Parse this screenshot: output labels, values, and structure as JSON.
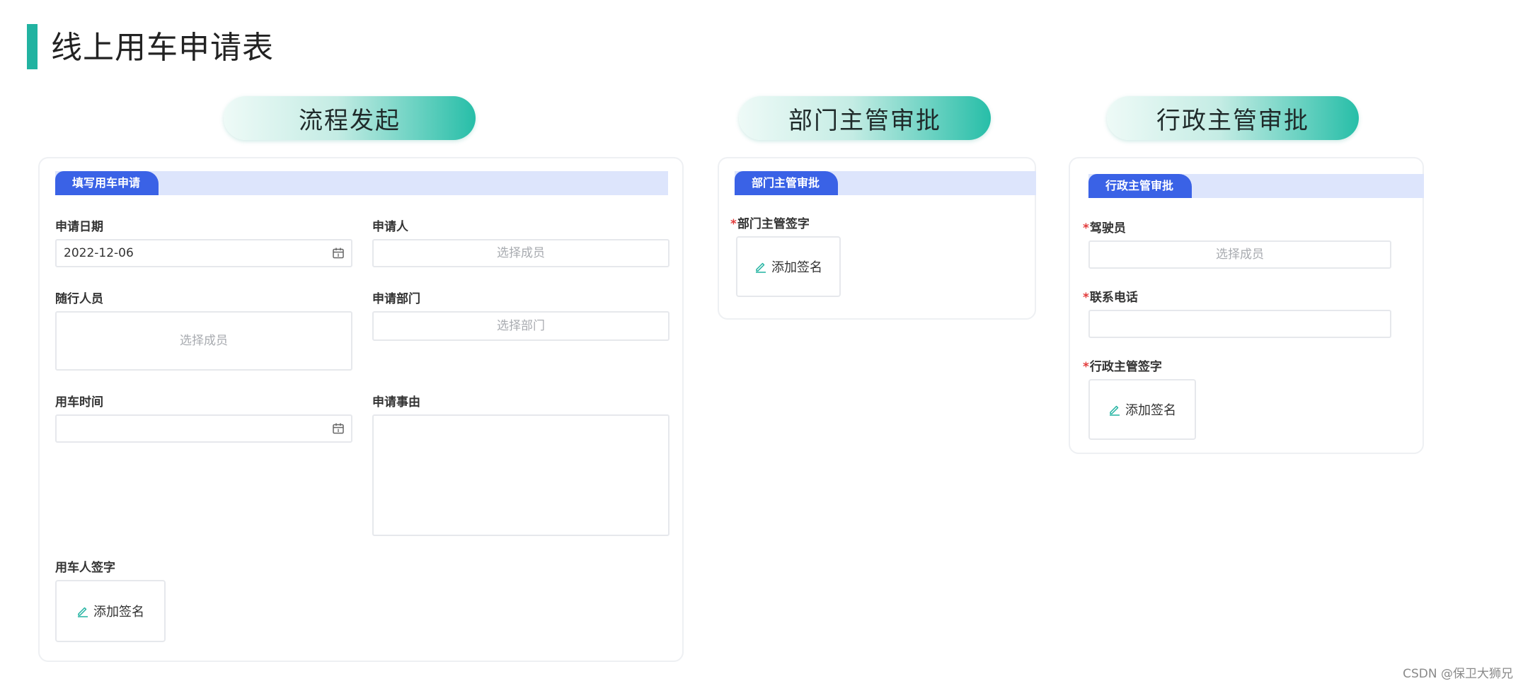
{
  "page": {
    "title": "线上用车申请表"
  },
  "steps": [
    {
      "label": "流程发起"
    },
    {
      "label": "部门主管审批"
    },
    {
      "label": "行政主管审批"
    }
  ],
  "form1": {
    "tag": "填写用车申请",
    "apply_date": {
      "label": "申请日期",
      "value": "2022-12-06"
    },
    "applicant": {
      "label": "申请人",
      "placeholder": "选择成员"
    },
    "companions": {
      "label": "随行人员",
      "placeholder": "选择成员"
    },
    "department": {
      "label": "申请部门",
      "placeholder": "选择部门"
    },
    "use_time": {
      "label": "用车时间",
      "value": ""
    },
    "reason": {
      "label": "申请事由",
      "value": ""
    },
    "signature": {
      "label": "用车人签字",
      "button": "添加签名"
    }
  },
  "form2": {
    "tag": "部门主管审批",
    "signature": {
      "required": "*",
      "label": "部门主管签字",
      "button": "添加签名"
    }
  },
  "form3": {
    "tag": "行政主管审批",
    "driver": {
      "required": "*",
      "label": "驾驶员",
      "placeholder": "选择成员"
    },
    "phone": {
      "required": "*",
      "label": "联系电话",
      "value": ""
    },
    "signature": {
      "required": "*",
      "label": "行政主管签字",
      "button": "添加签名"
    }
  },
  "watermark": "CSDN @保卫大狮兄",
  "icons": {
    "calendar": "calendar-icon",
    "pen": "pen-icon"
  },
  "colors": {
    "accent": "#21b3a1",
    "tag_blue": "#3a62e6",
    "band": "#dde5fc",
    "required": "#e23b3b"
  }
}
